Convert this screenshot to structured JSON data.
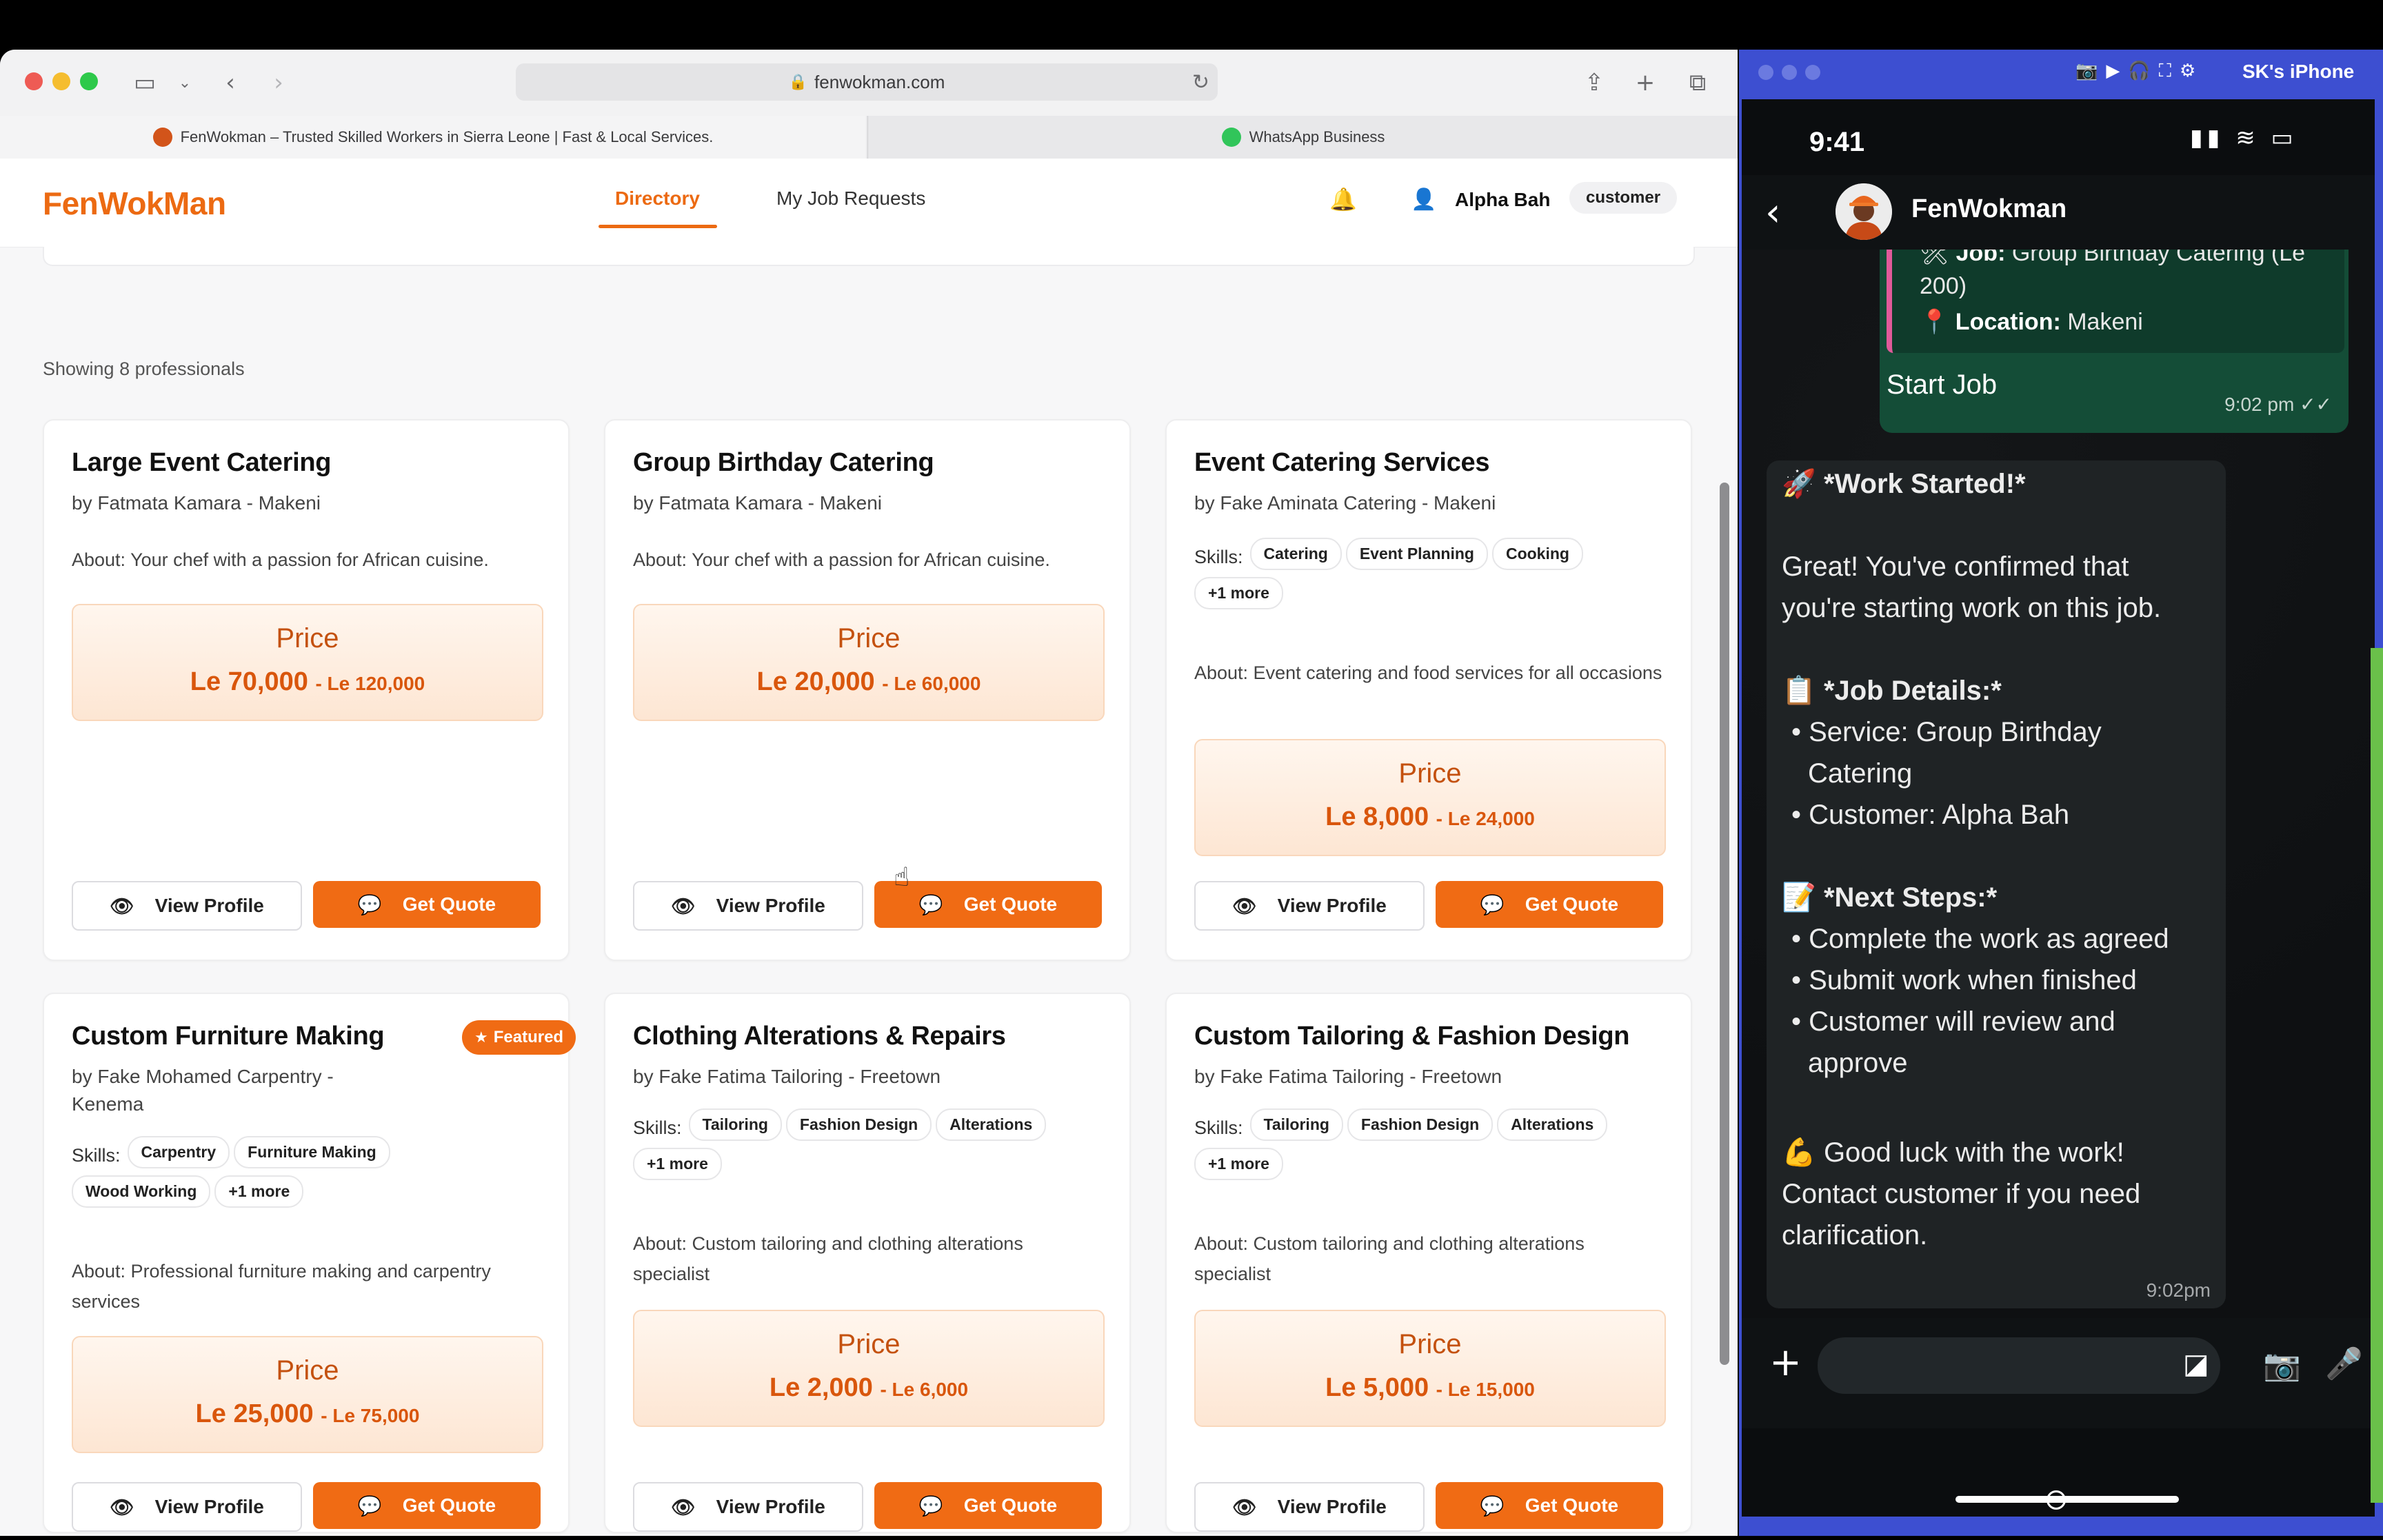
{
  "browser": {
    "url": "fenwokman.com",
    "tabs": [
      {
        "title": "FenWokman – Trusted Skilled Workers in Sierra Leone | Fast & Local Services."
      },
      {
        "title": "WhatsApp Business"
      }
    ]
  },
  "app": {
    "logo": "FenWokMan",
    "nav": {
      "directory": "Directory",
      "jobs": "My Job Requests"
    },
    "user": {
      "name": "Alpha Bah",
      "role": "customer"
    },
    "showing": "Showing 8 professionals",
    "price_label": "Price",
    "view_label": "View Profile",
    "quote_label": "Get Quote",
    "featured_label": "Featured",
    "skills_label": "Skills:",
    "cards": [
      {
        "title": "Large Event Catering",
        "by": "by Fatmata Kamara - Makeni",
        "about": "About: Your chef with a passion for African cuisine.",
        "price_min": "Le 70,000",
        "price_max": "- Le 120,000"
      },
      {
        "title": "Group Birthday Catering",
        "by": "by Fatmata Kamara - Makeni",
        "about": "About: Your chef with a passion for African cuisine.",
        "price_min": "Le 20,000",
        "price_max": "- Le 60,000"
      },
      {
        "title": "Event Catering Services",
        "by": "by Fake Aminata Catering - Makeni",
        "skills": [
          "Catering",
          "Event Planning",
          "Cooking",
          "+1 more"
        ],
        "about": "About: Event catering and food services for all occasions",
        "price_min": "Le 8,000",
        "price_max": "- Le 24,000"
      },
      {
        "title": "Custom Furniture Making",
        "by": "by Fake Mohamed Carpentry - Kenema",
        "skills": [
          "Carpentry",
          "Furniture Making",
          "Wood Working",
          "+1 more"
        ],
        "about": "About: Professional furniture making and carpentry services",
        "price_min": "Le 25,000",
        "price_max": "- Le 75,000"
      },
      {
        "title": "Clothing Alterations & Repairs",
        "by": "by Fake Fatima Tailoring - Freetown",
        "skills": [
          "Tailoring",
          "Fashion Design",
          "Alterations",
          "+1 more"
        ],
        "about": "About: Custom tailoring and clothing alterations specialist",
        "price_min": "Le 2,000",
        "price_max": "- Le 6,000"
      },
      {
        "title": "Custom Tailoring & Fashion Design",
        "by": "by Fake Fatima Tailoring - Freetown",
        "skills": [
          "Tailoring",
          "Fashion Design",
          "Alterations",
          "+1 more"
        ],
        "about": "About: Custom tailoring and clothing alterations specialist",
        "price_min": "Le 5,000",
        "price_max": "- Le 15,000"
      }
    ]
  },
  "phone": {
    "device_name": "SK's iPhone",
    "time": "9:41",
    "contact": "FenWokman",
    "outgoing": {
      "job_label": "Job:",
      "job_value": "Group Birthday  Catering (Le",
      "job_value2": "200)",
      "location_label": "Location:",
      "location_value": "Makeni",
      "text": "Start Job",
      "time": "9:02 pm ✓✓"
    },
    "incoming": {
      "lines": [
        "*Work Started!*",
        "Great! You've confirmed that",
        "you're starting work on this job.",
        "*Job Details:*",
        "• Service: Group Birthday",
        "Catering",
        "• Customer: Alpha Bah",
        "*Next Steps:*",
        "• Complete the work as agreed",
        "• Submit work when finished",
        "• Customer will review and",
        "approve",
        "Good luck with the work!",
        "Contact customer if you need",
        "clarification."
      ],
      "time": "9:02pm"
    }
  }
}
